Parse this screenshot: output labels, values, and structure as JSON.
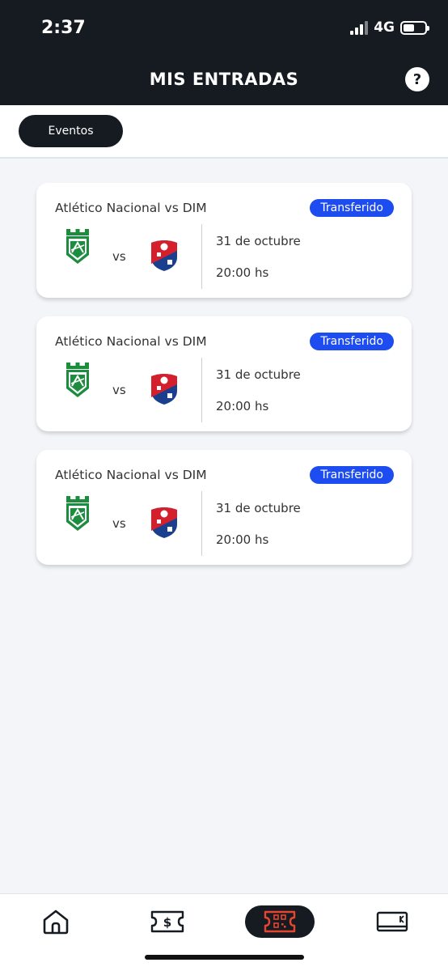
{
  "status_bar": {
    "time": "2:37",
    "network": "4G",
    "battery_percent": 50
  },
  "header": {
    "title": "MIS ENTRADAS",
    "help_label": "?"
  },
  "filters": {
    "active": "Eventos"
  },
  "tickets": [
    {
      "match": "Atlético Nacional vs DIM",
      "status": "Transferido",
      "vs": "vs",
      "date": "31 de octubre",
      "time": "20:00 hs"
    },
    {
      "match": "Atlético Nacional vs DIM",
      "status": "Transferido",
      "vs": "vs",
      "date": "31 de octubre",
      "time": "20:00 hs"
    },
    {
      "match": "Atlético Nacional vs DIM",
      "status": "Transferido",
      "vs": "vs",
      "date": "31 de octubre",
      "time": "20:00 hs"
    }
  ],
  "nav": {
    "items": [
      {
        "icon": "home-icon"
      },
      {
        "icon": "money-ticket-icon"
      },
      {
        "icon": "qr-ticket-icon",
        "active": true
      },
      {
        "icon": "card-icon"
      }
    ]
  },
  "colors": {
    "header_bg": "#161b22",
    "badge_blue": "#1d4cf1",
    "accent_red": "#e8442e",
    "nacional_green": "#1c8c3e",
    "dim_red": "#d4202d",
    "dim_blue": "#1a3f8f"
  }
}
